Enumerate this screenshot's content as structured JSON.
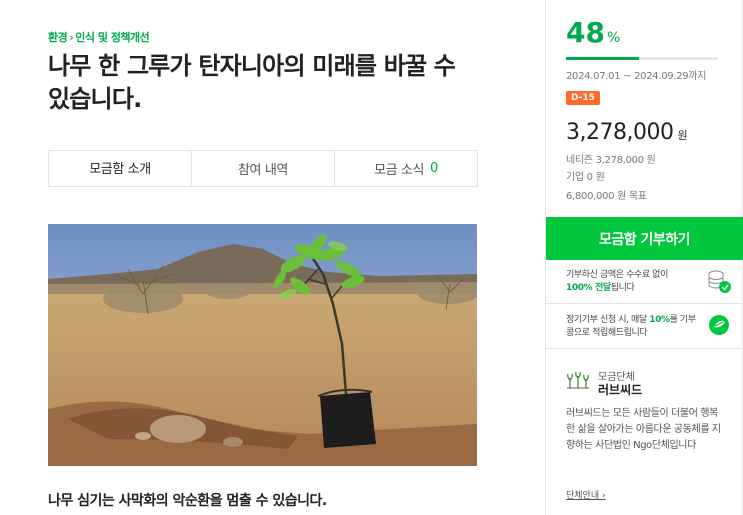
{
  "breadcrumb": {
    "category": "환경",
    "subcategory": "인식 및 정책개선"
  },
  "title": "나무 한 그루가 탄자니아의 미래를 바꿀 수 있습니다.",
  "tabs": [
    {
      "label": "모금함 소개"
    },
    {
      "label": "참여 내역"
    },
    {
      "label": "모금 소식",
      "count": "0"
    }
  ],
  "subtitle": "나무 심기는 사막화의 악순환을 멈출 수 있습니다.",
  "campaign": {
    "percent": "48",
    "percent_unit": "%",
    "progress_fraction": 0.48,
    "period": "2024.07.01 ~ 2024.09.29까지",
    "dday": "D-15",
    "amount": "3,278,000",
    "amount_unit": "원",
    "netizen": "네티즌 3,278,000 원",
    "company": "기업 0 원",
    "goal": "6,800,000 원 목표"
  },
  "donate_button": "모금함 기부하기",
  "info1": {
    "pre": "기부하신 금액은 수수료 없이",
    "highlight": "100% 전달",
    "post": "됩니다"
  },
  "info2": {
    "pre": "정기기부 신청 시, 매달",
    "highlight": "10%",
    "post": "를 기부콩으로 적립해드립니다"
  },
  "organization": {
    "label": "모금단체",
    "name": "러브씨드",
    "description": "러브씨드는 모든 사람들이 더불어 행복한 삶을 살아가는 아름다운 공동체를 지향하는 사단법인 Ngo단체입니다",
    "link": "단체안내 ›"
  },
  "colors": {
    "accent": "#00a94f",
    "button": "#00c73c",
    "dday": "#ff6a2c"
  }
}
